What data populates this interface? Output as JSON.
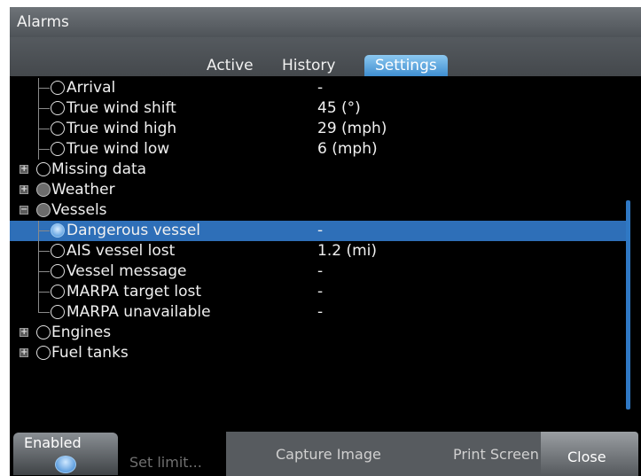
{
  "window": {
    "title": "Alarms"
  },
  "tabs": [
    {
      "label": "Active",
      "selected": false
    },
    {
      "label": "History",
      "selected": false
    },
    {
      "label": "Settings",
      "selected": true
    }
  ],
  "alarms": [
    {
      "name": "Arrival",
      "value": "-",
      "level": 1,
      "radio": "empty",
      "tree": "branch"
    },
    {
      "name": "True wind shift",
      "value": "45 (°)",
      "level": 1,
      "radio": "empty",
      "tree": "branch"
    },
    {
      "name": "True wind high",
      "value": "29 (mph)",
      "level": 1,
      "radio": "empty",
      "tree": "branch"
    },
    {
      "name": "True wind low",
      "value": "6 (mph)",
      "level": 1,
      "radio": "empty",
      "tree": "branch"
    },
    {
      "name": "Missing data",
      "value": "",
      "level": 0,
      "radio": "empty",
      "tree": "plus"
    },
    {
      "name": "Weather",
      "value": "",
      "level": 0,
      "radio": "filled",
      "tree": "plus"
    },
    {
      "name": "Vessels",
      "value": "",
      "level": 0,
      "radio": "filled",
      "tree": "minus"
    },
    {
      "name": "Dangerous vessel",
      "value": "-",
      "level": 1,
      "radio": "blue",
      "tree": "branch",
      "selected": true
    },
    {
      "name": "AIS vessel lost",
      "value": "1.2 (mi)",
      "level": 1,
      "radio": "empty",
      "tree": "branch"
    },
    {
      "name": "Vessel message",
      "value": "-",
      "level": 1,
      "radio": "empty",
      "tree": "branch"
    },
    {
      "name": "MARPA target lost",
      "value": "-",
      "level": 1,
      "radio": "empty",
      "tree": "branch"
    },
    {
      "name": "MARPA unavailable",
      "value": "-",
      "level": 1,
      "radio": "empty",
      "tree": "last"
    },
    {
      "name": "Engines",
      "value": "",
      "level": 0,
      "radio": "empty",
      "tree": "plus"
    },
    {
      "name": "Fuel tanks",
      "value": "",
      "level": 0,
      "radio": "empty",
      "tree": "plus"
    }
  ],
  "buttons": {
    "enabled": "Enabled",
    "set_limit": "Set limit...",
    "capture_image": "Capture Image",
    "print_screen": "Print Screen",
    "close": "Close"
  },
  "colors": {
    "selection": "#2e6fb8",
    "accent": "#3f8ed0"
  },
  "scroll_position": 0.55
}
